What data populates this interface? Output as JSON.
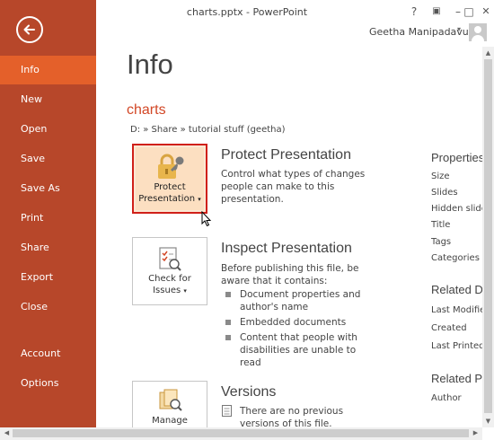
{
  "window": {
    "title": "charts.pptx - PowerPoint",
    "help_label": "?",
    "ribbon_label": "▣",
    "minimize_label": "–",
    "restore_label": "□",
    "close_label": "✕",
    "user_name": "Geetha Manipadavu",
    "user_caret": "▾"
  },
  "sidebar": {
    "back_icon": "arrow-left-icon",
    "items": [
      {
        "label": "Info",
        "active": true
      },
      {
        "label": "New"
      },
      {
        "label": "Open"
      },
      {
        "label": "Save"
      },
      {
        "label": "Save As"
      },
      {
        "label": "Print"
      },
      {
        "label": "Share"
      },
      {
        "label": "Export"
      },
      {
        "label": "Close"
      },
      {
        "label": "Account"
      },
      {
        "label": "Options"
      }
    ]
  },
  "main": {
    "page_title": "Info",
    "file_name": "charts",
    "file_path": "D: » Share » tutorial stuff (geetha)",
    "protect": {
      "tile_line1": "Protect",
      "tile_line2": "Presentation",
      "caret": "▾",
      "title": "Protect Presentation",
      "description": "Control what types of changes people can make to this presentation."
    },
    "inspect": {
      "tile_line1": "Check for",
      "tile_line2": "Issues",
      "caret": "▾",
      "title": "Inspect Presentation",
      "description": "Before publishing this file, be aware that it contains:",
      "bullets": [
        "Document properties and author's name",
        "Embedded documents",
        "Content that people with disabilities are unable to read"
      ]
    },
    "versions": {
      "tile_label": "Manage",
      "title": "Versions",
      "description": "There are no previous versions of this file."
    }
  },
  "properties": {
    "heading": "Properties",
    "items": [
      "Size",
      "Slides",
      "Hidden slide",
      "Title",
      "Tags",
      "Categories"
    ],
    "related_dates_heading": "Related D",
    "date_items": [
      "Last Modifie",
      "Created",
      "Last Printed"
    ],
    "related_people_heading": "Related P",
    "people_items": [
      "Author"
    ]
  },
  "colors": {
    "sidebar": "#b7472a",
    "sidebar_active": "#e4602a",
    "accent_text": "#d24726",
    "highlight_border": "#d0201a"
  }
}
